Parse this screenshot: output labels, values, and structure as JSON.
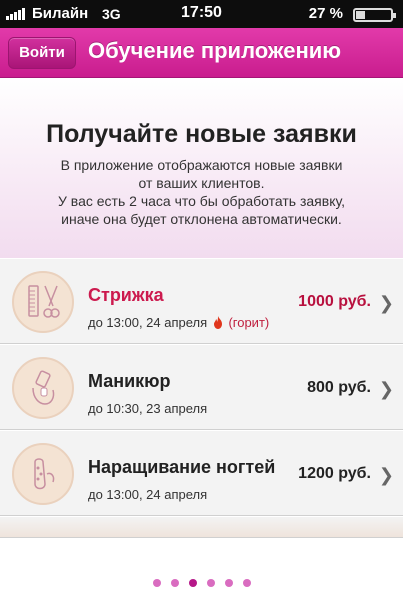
{
  "status_bar": {
    "carrier": "Билайн",
    "network": "3G",
    "time": "17:50",
    "battery": "27 %",
    "battery_level": 0.27
  },
  "nav": {
    "login_label": "Войти",
    "title": "Обучение приложению"
  },
  "intro": {
    "heading": "Получайте новые заявки",
    "line1": "В приложение отображаются новые заявки",
    "line2": "от ваших клиентов.",
    "line3": "У вас есть 2 часа что бы обработать заявку,",
    "line4": "иначе она будет отклонена автоматически."
  },
  "requests": [
    {
      "name": "Стрижка",
      "date": "до 13:00, 24 апреля",
      "status": "(горит)",
      "price": "1000 руб.",
      "icon": "haircut-icon"
    },
    {
      "name": "Маникюр",
      "date": "до 10:30, 23 апреля",
      "price": "800 руб.",
      "icon": "manicure-icon"
    },
    {
      "name": "Наращивание ногтей",
      "date": "до 13:00, 24 апреля",
      "price": "1200 руб.",
      "icon": "nail-extension-icon"
    }
  ],
  "pager": {
    "count": 6,
    "active_index": 2
  },
  "colors": {
    "accent": "#d12b9c",
    "hot": "#cc1a4e"
  }
}
